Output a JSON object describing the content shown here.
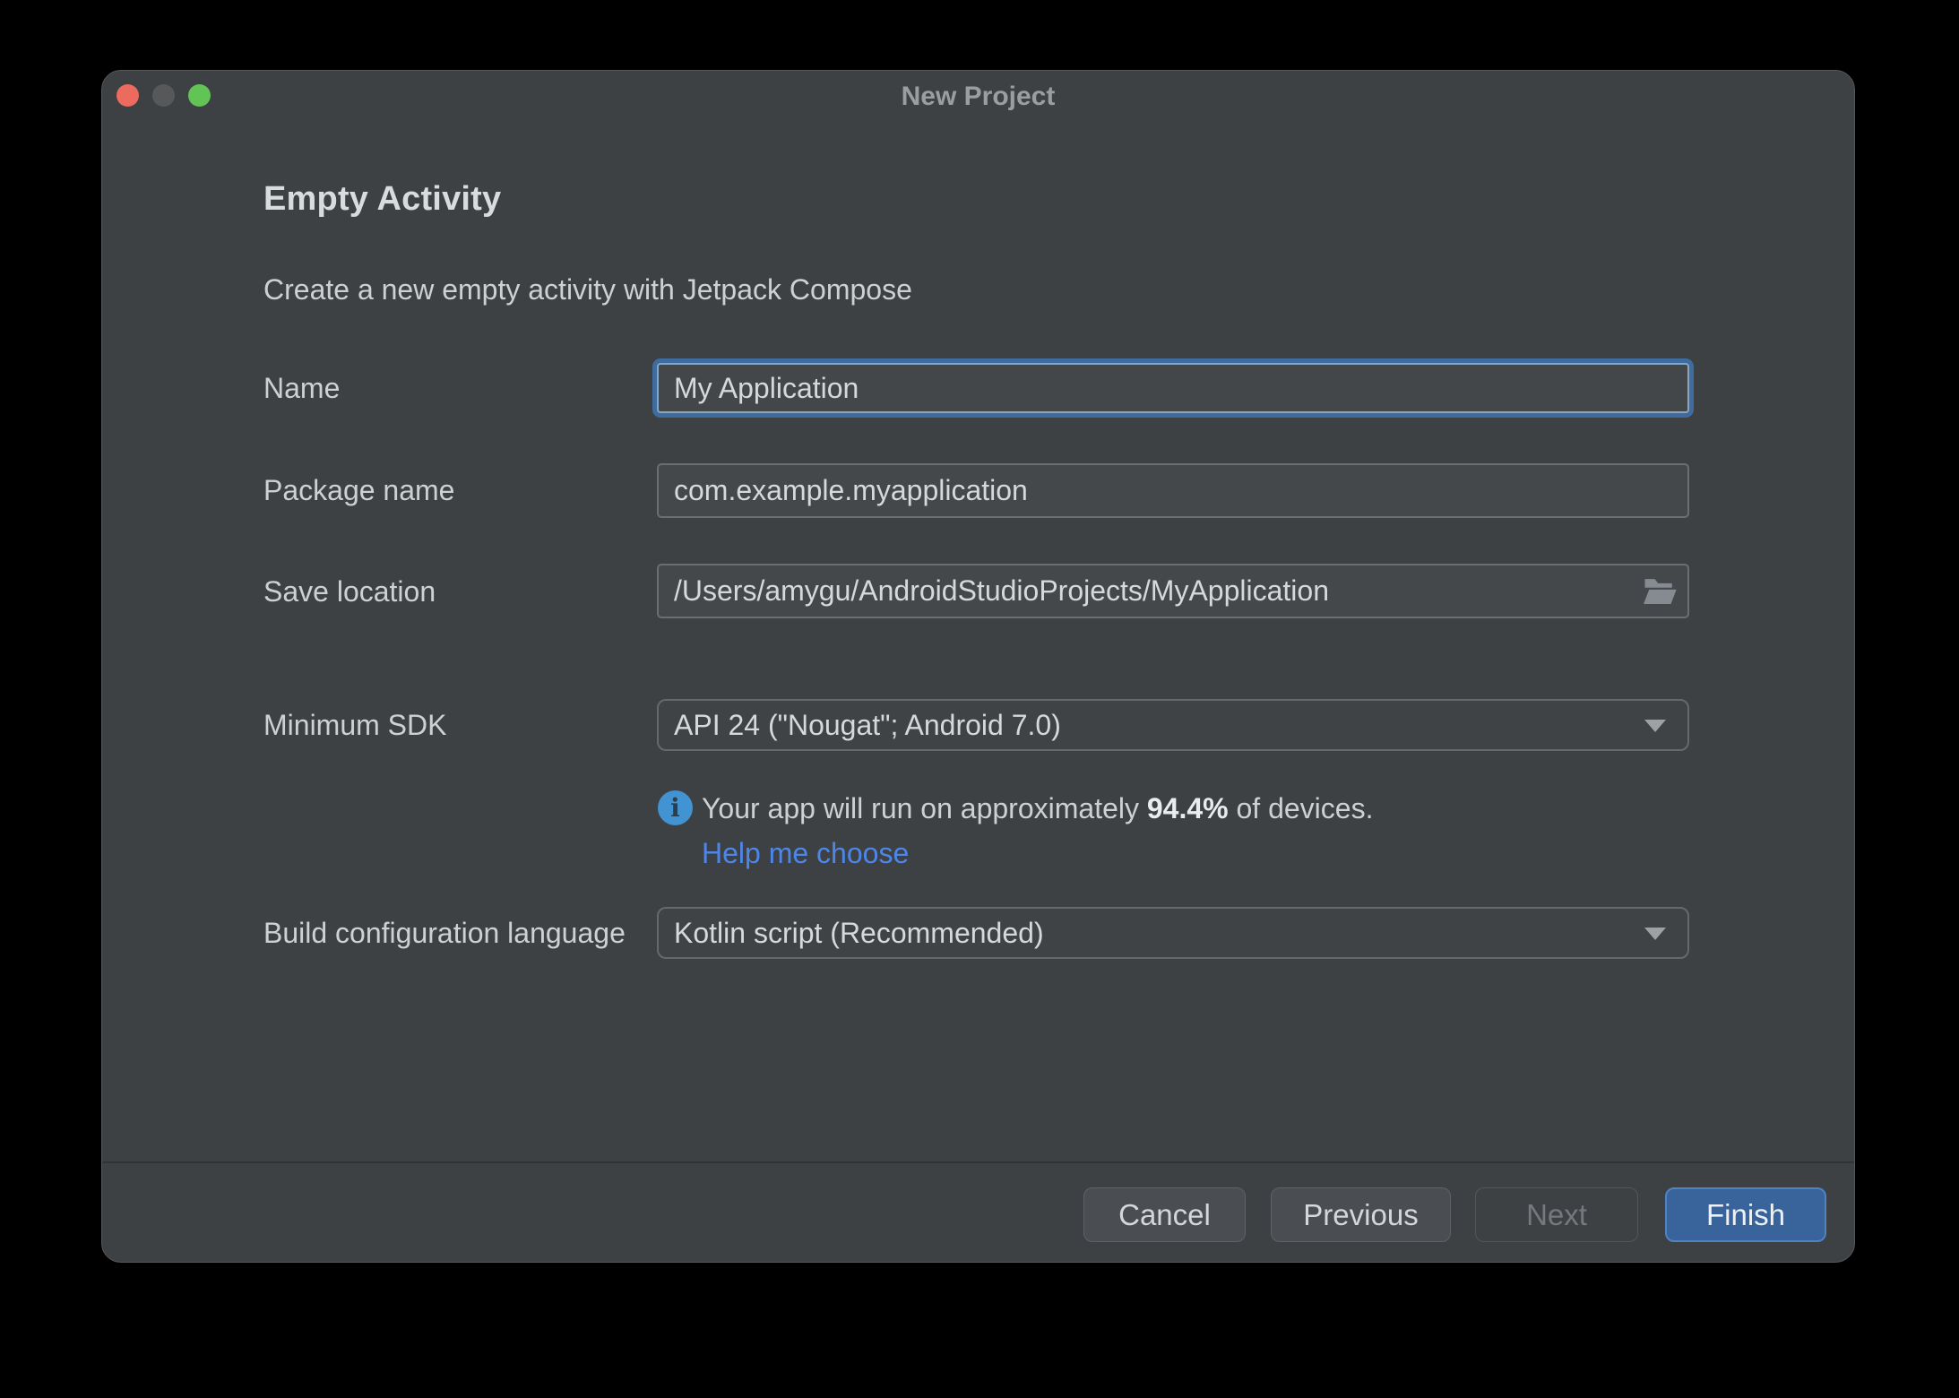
{
  "window": {
    "title": "New Project",
    "traffic_lights": [
      "close",
      "minimize",
      "zoom"
    ]
  },
  "header": {
    "title": "Empty Activity",
    "subtitle": "Create a new empty activity with Jetpack Compose"
  },
  "form": {
    "name": {
      "label": "Name",
      "value": "My Application",
      "focused": true
    },
    "package": {
      "label": "Package name",
      "value": "com.example.myapplication"
    },
    "save_location": {
      "label": "Save location",
      "value": "/Users/amygu/AndroidStudioProjects/MyApplication",
      "icon": "folder-open-icon"
    },
    "min_sdk": {
      "label": "Minimum SDK",
      "value": "API 24 (\"Nougat\"; Android 7.0)"
    },
    "sdk_info": {
      "icon": "info-icon",
      "text_prefix": "Your app will run on approximately ",
      "percent": "94.4%",
      "text_suffix": " of devices.",
      "link": "Help me choose"
    },
    "build_config": {
      "label": "Build configuration language",
      "value": "Kotlin script (Recommended)"
    }
  },
  "footer": {
    "buttons": [
      {
        "label": "Cancel",
        "style": "default",
        "enabled": true
      },
      {
        "label": "Previous",
        "style": "default",
        "enabled": true
      },
      {
        "label": "Next",
        "style": "default",
        "enabled": false
      },
      {
        "label": "Finish",
        "style": "primary",
        "enabled": true
      }
    ]
  },
  "colors": {
    "page_background": "#000000",
    "dialog_background": "#3e4143",
    "focus_ring_blue": "#3f6c9e",
    "link_blue": "#4e86e8",
    "finish_button_blue": "#39639b",
    "info_icon_blue": "#4193d1",
    "traffic_close_red": "#ec6a5e",
    "traffic_minimize_gray": "#565859",
    "traffic_zoom_green": "#61c454"
  }
}
